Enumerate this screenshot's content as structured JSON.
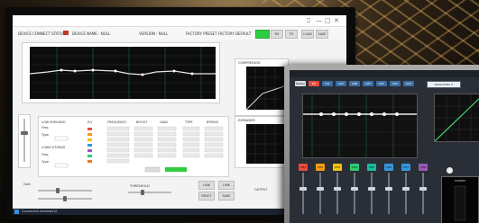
{
  "desktop": {
    "titlebar": {
      "buttons": [
        "⎕",
        "—",
        "□",
        "✕"
      ]
    },
    "header": {
      "device_connect": "DEVICE CONNECT STATUS",
      "device_name": "DEVICE NAME : NULL",
      "version": "VERSION : NULL",
      "preset": "FACTORY PRESET  FACTORY DEFAULT",
      "buttons": [
        "",
        "RX",
        "TX",
        "LOAD",
        "SAVE"
      ]
    },
    "eq": {
      "label": "EQ"
    },
    "compressor": {
      "label": "COMPRESSOR"
    },
    "expander": {
      "label": "EXPANDER"
    },
    "table": {
      "headers": [
        "EQ",
        "FREQUENCY",
        "BOOST",
        "GAIN",
        "TYPE",
        "BYPASS"
      ],
      "left_labels": [
        "LOW SHELVING",
        "Freq",
        "Type",
        "LOW/CUT/PASS",
        "Freq",
        "Type"
      ]
    },
    "bottom": {
      "gain": "Gain",
      "threshold": "THRESHOLD",
      "buttons": [
        "LINK",
        "LINK",
        "RESET",
        "SAVE"
      ],
      "footer": "OUTPUT"
    },
    "taskbar": {
      "text": "Connected  windows10"
    }
  },
  "laptop": {
    "top_buttons": [
      "Master",
      "EQ",
      "DLY",
      "GAT",
      "CMP",
      "LMT",
      "MIX",
      "XOV",
      "AUX"
    ],
    "preset_box": "Default Mix 2",
    "channel_buttons": [
      "CH1",
      "CH2",
      "CH3",
      "CH4",
      "CH5",
      "CH6",
      "CH7",
      "CH8"
    ],
    "channel_colors": [
      "#e74c3c",
      "#f39c12",
      "#f1c40f",
      "#2ecc71",
      "#1abc9c",
      "#3498db",
      "#3498db",
      "#9b59b6"
    ],
    "meter": {
      "label": "master"
    }
  }
}
